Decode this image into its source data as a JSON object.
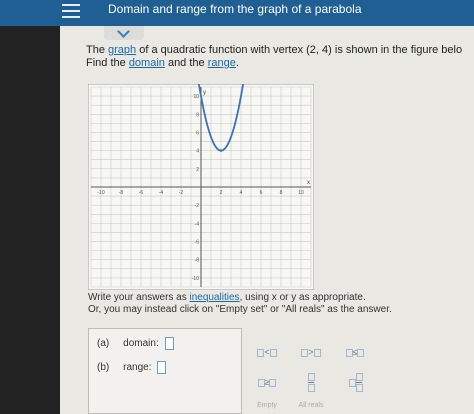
{
  "header": {
    "title": "Domain and range from the graph of a parabola"
  },
  "problem": {
    "line1_a": "The ",
    "line1_link": "graph",
    "line1_b": " of a quadratic function with vertex ",
    "vertex": "(2, 4)",
    "line1_c": " is shown in the figure belo",
    "line2_a": "Find the ",
    "line2_link1": "domain",
    "line2_b": " and the ",
    "line2_link2": "range",
    "line2_c": "."
  },
  "chart_data": {
    "type": "line",
    "title": "",
    "xlabel": "x",
    "ylabel": "y",
    "xlim": [
      -11,
      11
    ],
    "ylim": [
      -11,
      11
    ],
    "grid": true,
    "x_ticks": [
      -10,
      -8,
      -6,
      -4,
      -2,
      2,
      4,
      6,
      8,
      10
    ],
    "y_ticks": [
      10,
      8,
      6,
      4,
      2,
      -2,
      -4,
      -6,
      -8,
      -10
    ],
    "series": [
      {
        "function": "y = 1.5(x - 2)^2 + 4",
        "x_range": [
          -0.5,
          4.5
        ],
        "vertex": [
          2,
          4
        ],
        "arrows": "both-ends"
      }
    ]
  },
  "instructions": {
    "line1_a": "Write your answers as ",
    "line1_link": "inequalities",
    "line1_b": ", using x or y as appropriate.",
    "line2": "Or, you may instead click on \"Empty set\" or \"All reals\" as the answer."
  },
  "answers": {
    "domain_label": "(a)",
    "domain_text": "domain:",
    "range_label": "(b)",
    "range_text": "range:"
  },
  "keypad": {
    "lt": "<",
    "gt": ">",
    "le": "≤",
    "ge": "≥",
    "empty_label": "Empty",
    "allreals_label": "All reals"
  }
}
